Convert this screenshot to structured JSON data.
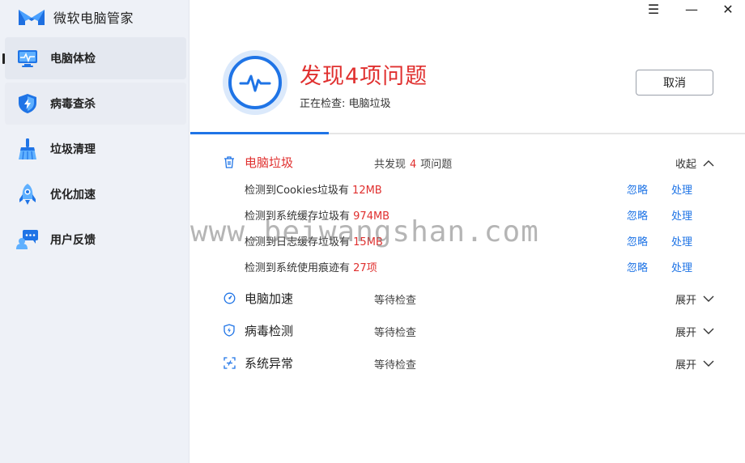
{
  "app": {
    "title": "微软电脑管家"
  },
  "window_controls": {
    "menu": "☰",
    "minimize": "—",
    "close": "✕"
  },
  "sidebar": {
    "items": [
      {
        "label": "电脑体检",
        "icon": "monitor-pulse-icon"
      },
      {
        "label": "病毒查杀",
        "icon": "shield-bolt-icon"
      },
      {
        "label": "垃圾清理",
        "icon": "broom-icon"
      },
      {
        "label": "优化加速",
        "icon": "rocket-icon"
      },
      {
        "label": "用户反馈",
        "icon": "feedback-user-icon"
      }
    ]
  },
  "header": {
    "headline": "发现4项问题",
    "status": "正在检查: 电脑垃圾",
    "cancel_label": "取消",
    "progress": 0.25
  },
  "sections": [
    {
      "title": "电脑垃圾",
      "icon": "trash-icon",
      "status_prefix": "共发现",
      "status_count": "4",
      "status_suffix": "项问题",
      "toggle": "收起",
      "items": [
        {
          "text": "检测到Cookies垃圾有",
          "amount": "12MB",
          "ignore": "忽略",
          "handle": "处理"
        },
        {
          "text": "检测到系统缓存垃圾有",
          "amount": "974MB",
          "ignore": "忽略",
          "handle": "处理"
        },
        {
          "text": "检测到日志缓存垃圾有",
          "amount": "15MB",
          "ignore": "忽略",
          "handle": "处理"
        },
        {
          "text": "检测到系统使用痕迹有",
          "amount": "27项",
          "ignore": "忽略",
          "handle": "处理"
        }
      ]
    },
    {
      "title": "电脑加速",
      "icon": "speedometer-icon",
      "status": "等待检查",
      "toggle": "展开"
    },
    {
      "title": "病毒检测",
      "icon": "shield-bolt-icon",
      "status": "等待检查",
      "toggle": "展开"
    },
    {
      "title": "系统异常",
      "icon": "scan-frame-icon",
      "status": "等待检查",
      "toggle": "展开"
    }
  ],
  "watermark": "www.beiwangshan.com",
  "colors": {
    "accent": "#1f74e6",
    "alert": "#e0302f",
    "sidebar_bg": "#eef1f7"
  }
}
